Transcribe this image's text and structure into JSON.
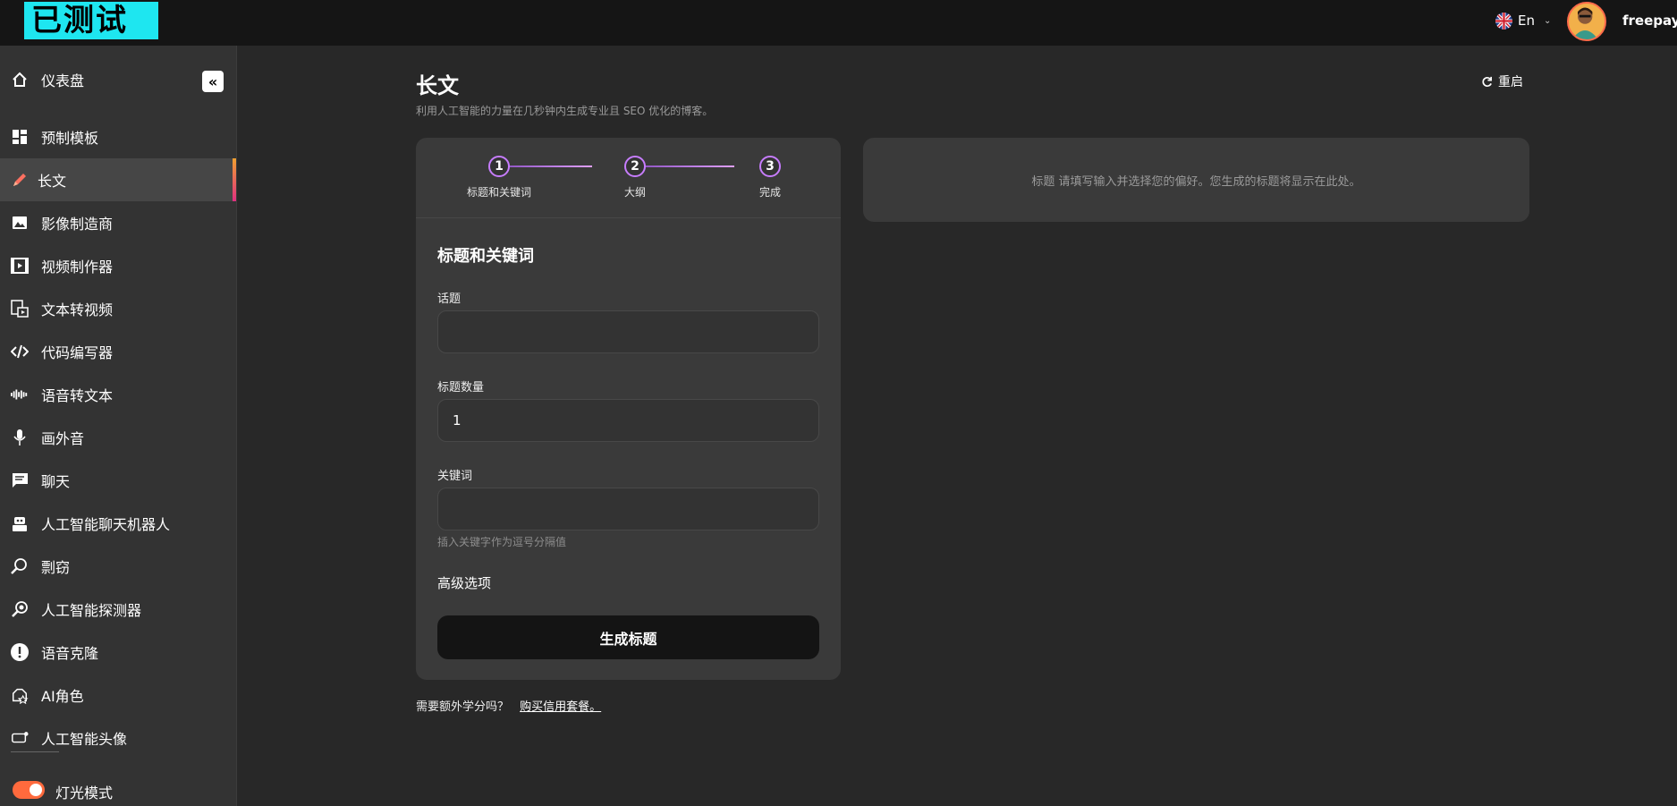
{
  "header": {
    "logo_text": "已测试",
    "language": "En",
    "username": "freepayz"
  },
  "sidebar": {
    "items": [
      {
        "label": "仪表盘",
        "icon": "home-icon"
      },
      {
        "label": "预制模板",
        "icon": "grid-icon"
      },
      {
        "label": "长文",
        "icon": "pencil-icon"
      },
      {
        "label": "影像制造商",
        "icon": "image-icon"
      },
      {
        "label": "视频制作器",
        "icon": "film-icon"
      },
      {
        "label": "文本转视频",
        "icon": "text-video-icon"
      },
      {
        "label": "代码编写器",
        "icon": "code-icon"
      },
      {
        "label": "语音转文本",
        "icon": "waveform-icon"
      },
      {
        "label": "画外音",
        "icon": "microphone-icon"
      },
      {
        "label": "聊天",
        "icon": "chat-icon"
      },
      {
        "label": "人工智能聊天机器人",
        "icon": "robot-icon"
      },
      {
        "label": "剽窃",
        "icon": "search-doc-icon"
      },
      {
        "label": "人工智能探测器",
        "icon": "magnifier-icon"
      },
      {
        "label": "语音克隆",
        "icon": "alert-icon"
      },
      {
        "label": "AI角色",
        "icon": "character-icon"
      },
      {
        "label": "人工智能头像",
        "icon": "avatar-icon"
      }
    ],
    "light_mode_label": "灯光模式"
  },
  "main": {
    "title": "长文",
    "subtitle": "利用人工智能的力量在几秒钟内生成专业且 SEO 优化的博客。",
    "reset_label": "重启",
    "steps": [
      {
        "number": "1",
        "label": "标题和关键词"
      },
      {
        "number": "2",
        "label": "大纲"
      },
      {
        "number": "3",
        "label": "完成"
      }
    ],
    "section_title": "标题和关键词",
    "fields": {
      "topic_label": "话题",
      "topic_value": "",
      "count_label": "标题数量",
      "count_value": "1",
      "keywords_label": "关键词",
      "keywords_value": "",
      "keywords_hint": "插入关键字作为逗号分隔值"
    },
    "advanced_label": "高级选项",
    "generate_label": "生成标题",
    "credits_text": "需要额外学分吗？",
    "credits_link": "购买信用套餐。",
    "output_placeholder": "标题 请填写输入并选择您的偏好。您生成的标题将显示在此处。"
  }
}
